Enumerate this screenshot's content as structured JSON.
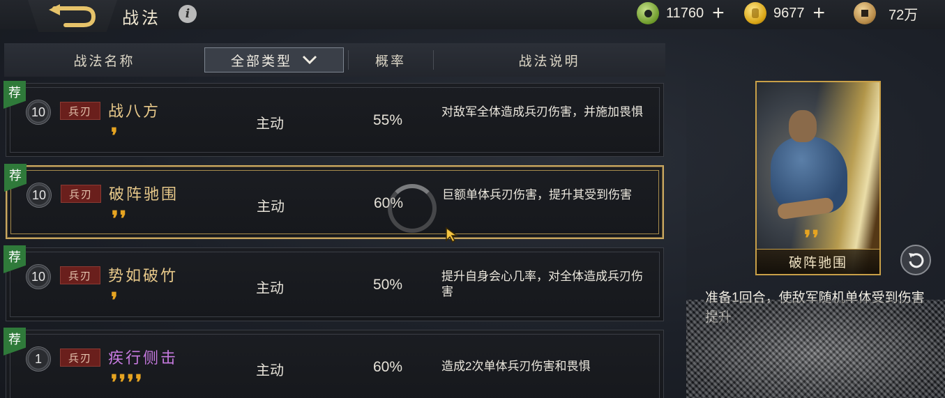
{
  "header": {
    "title": "战法",
    "currencies": [
      {
        "icon": "jade-coin-icon",
        "value": "11760",
        "has_plus": true
      },
      {
        "icon": "gold-ingot-icon",
        "value": "9677",
        "has_plus": true
      },
      {
        "icon": "copper-coin-icon",
        "value": "72万",
        "has_plus": false
      }
    ]
  },
  "list_header": {
    "name_col": "战法名称",
    "type_filter": "全部类型",
    "prob_col": "概率",
    "desc_col": "战法说明"
  },
  "rows": [
    {
      "tag": "荐",
      "level": "10",
      "weapon": "兵刃",
      "name": "战八方",
      "quotes": 1,
      "type": "主动",
      "prob": "55%",
      "desc": "对敌军全体造成兵刃伤害，并施加畏惧"
    },
    {
      "tag": "荐",
      "level": "10",
      "weapon": "兵刃",
      "name": "破阵驰围",
      "quotes": 2,
      "type": "主动",
      "prob": "60%",
      "desc": "巨额单体兵刃伤害，提升其受到伤害"
    },
    {
      "tag": "荐",
      "level": "10",
      "weapon": "兵刃",
      "name": "势如破竹",
      "quotes": 1,
      "type": "主动",
      "prob": "50%",
      "desc": "提升自身会心几率，对全体造成兵刃伤害"
    },
    {
      "tag": "荐",
      "level": "1",
      "weapon": "兵刃",
      "name": "疾行侧击",
      "quotes": 4,
      "type": "主动",
      "prob": "60%",
      "desc": "造成2次单体兵刃伤害和畏惧"
    }
  ],
  "selected_index": 1,
  "side_panel": {
    "card_name": "破阵驰围",
    "card_quotes": 2,
    "description": "准备1回合，使敌军随机单体受到伤害提升"
  },
  "colors": {
    "gold_border": "#c9a048",
    "rec_green": "#2f7a3a",
    "weapon_red": "#6a1f1c",
    "quote_gold": "#e6a421"
  }
}
